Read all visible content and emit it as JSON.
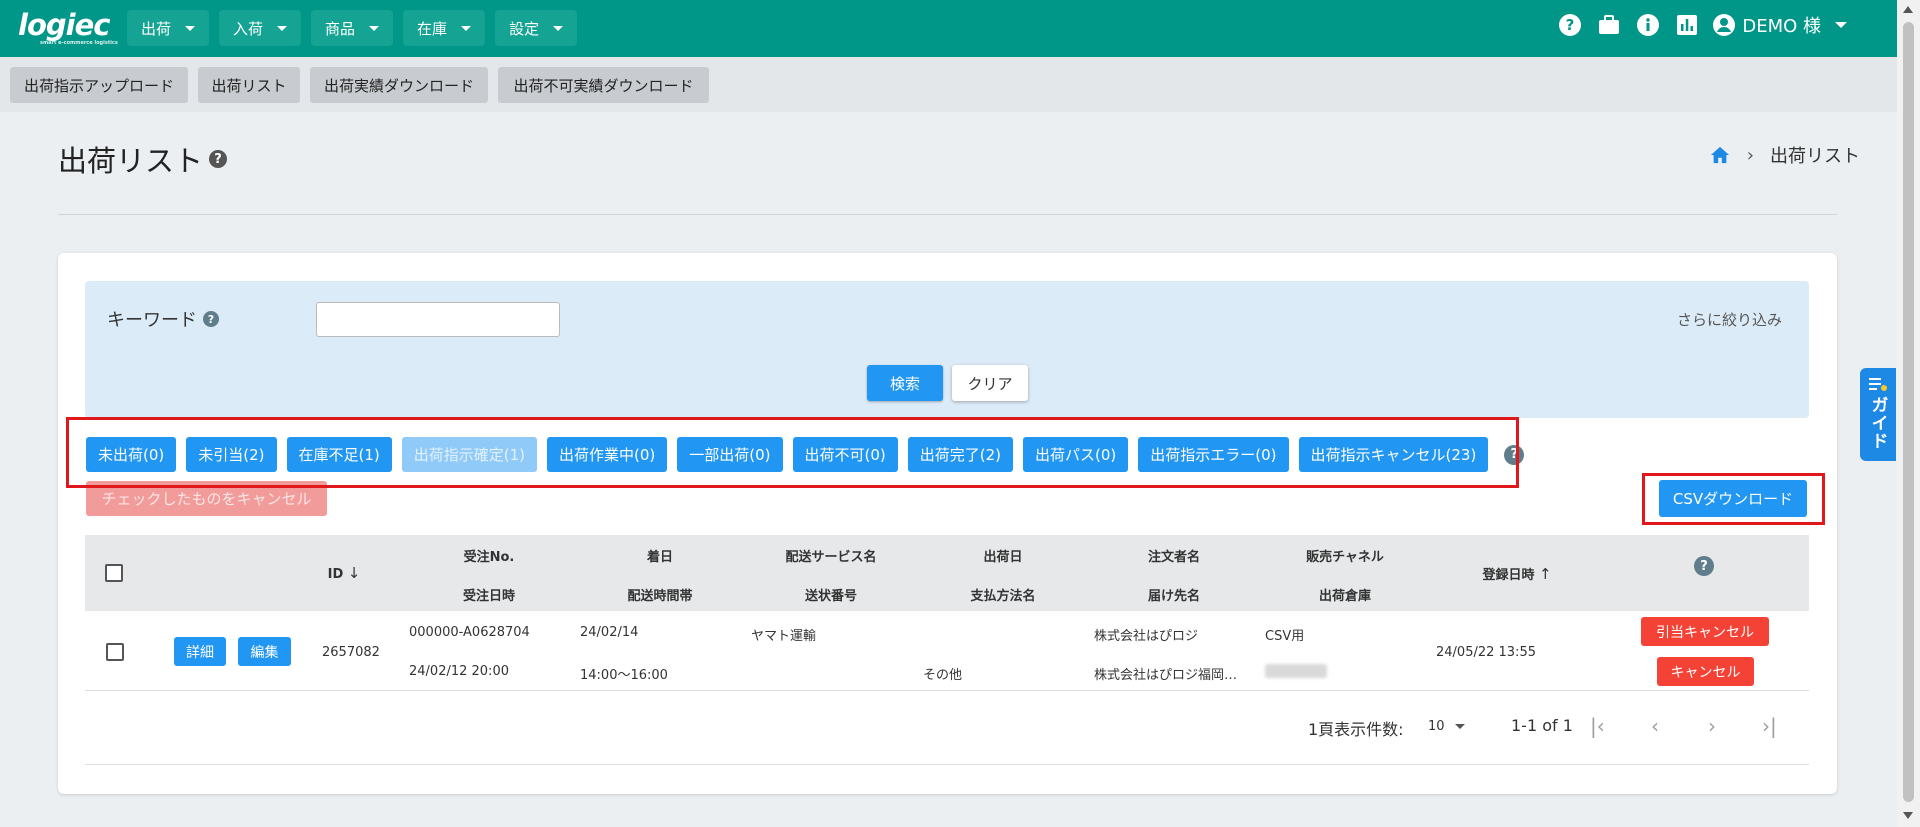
{
  "header": {
    "logo": "logiec",
    "logo_sub": "smart e-commerce logistics",
    "nav": [
      "出荷",
      "入荷",
      "商品",
      "在庫",
      "設定"
    ],
    "user": "DEMO 様"
  },
  "toolbar": {
    "buttons": [
      "出荷指示アップロード",
      "出荷リスト",
      "出荷実績ダウンロード",
      "出荷不可実績ダウンロード"
    ]
  },
  "page": {
    "title": "出荷リスト",
    "breadcrumb_current": "出荷リスト"
  },
  "search": {
    "keyword_label": "キーワード",
    "keyword_value": "",
    "refine": "さらに絞り込み",
    "search_btn": "検索",
    "clear_btn": "クリア"
  },
  "status_filters": [
    {
      "label": "未出荷(0)",
      "enabled": true
    },
    {
      "label": "未引当(2)",
      "enabled": true
    },
    {
      "label": "在庫不足(1)",
      "enabled": true
    },
    {
      "label": "出荷指示確定(1)",
      "enabled": false
    },
    {
      "label": "出荷作業中(0)",
      "enabled": true
    },
    {
      "label": "一部出荷(0)",
      "enabled": true
    },
    {
      "label": "出荷不可(0)",
      "enabled": true
    },
    {
      "label": "出荷完了(2)",
      "enabled": true
    },
    {
      "label": "出荷パス(0)",
      "enabled": true
    },
    {
      "label": "出荷指示エラー(0)",
      "enabled": true
    },
    {
      "label": "出荷指示キャンセル(23)",
      "enabled": true
    }
  ],
  "actions": {
    "cancel_checked": "チェックしたものをキャンセル",
    "csv_download": "CSVダウンロード"
  },
  "table": {
    "headers": {
      "id": "ID",
      "order_no": "受注No.",
      "order_date": "受注日時",
      "arrival_date": "着日",
      "delivery_time": "配送時間帯",
      "service": "配送サービス名",
      "tracking": "送状番号",
      "ship_date": "出荷日",
      "payment": "支払方法名",
      "customer": "注文者名",
      "recipient": "届け先名",
      "channel": "販売チャネル",
      "warehouse": "出荷倉庫",
      "registered": "登録日時"
    },
    "rows": [
      {
        "detail_btn": "詳細",
        "edit_btn": "編集",
        "id": "2657082",
        "order_no": "000000-A0628704",
        "order_date": "24/02/12 20:00",
        "arrival_date": "24/02/14",
        "delivery_time": "14:00〜16:00",
        "service": "ヤマト運輸",
        "tracking": "",
        "ship_date": "",
        "payment": "その他",
        "customer": "株式会社はぴロジ",
        "recipient": "株式会社はぴロジ福岡…",
        "channel": "CSV用",
        "registered": "24/05/22 13:55",
        "alloc_cancel_btn": "引当キャンセル",
        "cancel_btn": "キャンセル"
      }
    ]
  },
  "pagination": {
    "per_page_label": "1頁表示件数:",
    "per_page_value": "10",
    "range": "1-1 of 1"
  },
  "guide_tab": "ガイド",
  "colors": {
    "header": "#009688",
    "primary": "#2196f3",
    "danger": "#f44336",
    "highlight": "#e0181b"
  }
}
